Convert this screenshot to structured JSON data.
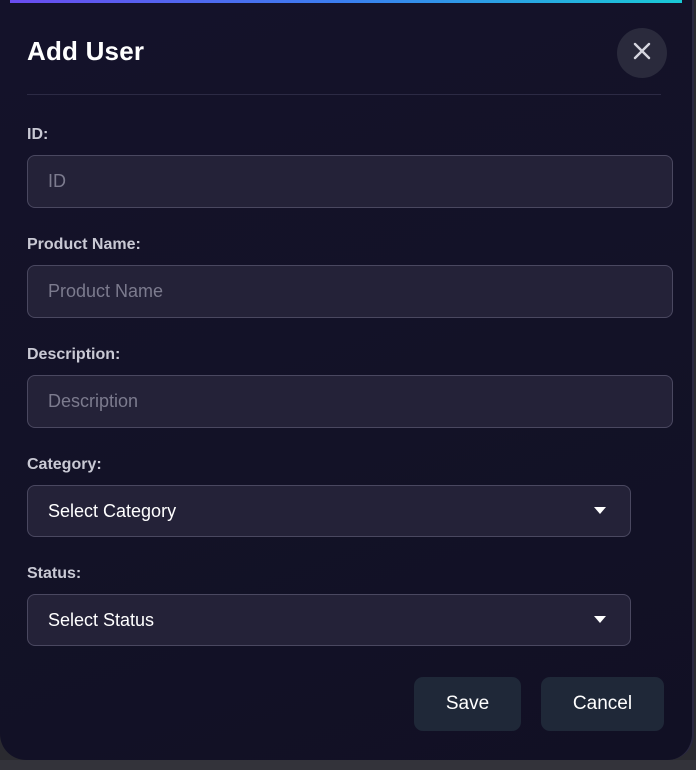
{
  "dialog": {
    "title": "Add User",
    "close_icon": "close-icon"
  },
  "form": {
    "fields": [
      {
        "label": "ID:",
        "placeholder": "ID",
        "value": ""
      },
      {
        "label": "Product Name:",
        "placeholder": "Product Name",
        "value": ""
      },
      {
        "label": "Description:",
        "placeholder": "Description",
        "value": ""
      }
    ],
    "category": {
      "label": "Category:",
      "selected": "Select Category"
    },
    "status": {
      "label": "Status:",
      "selected": "Select Status"
    }
  },
  "actions": {
    "save_label": "Save",
    "cancel_label": "Cancel"
  },
  "colors": {
    "background": "#131227",
    "input_bg": "#242238",
    "button_bg": "#1f2838",
    "accent_start": "#6a4cf0",
    "accent_end": "#19c9d6"
  }
}
